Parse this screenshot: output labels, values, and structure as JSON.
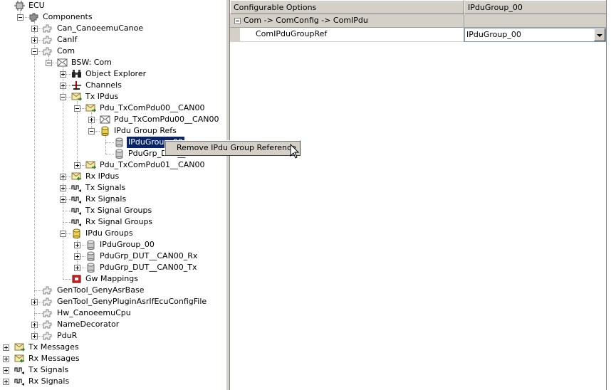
{
  "tree": {
    "items": [
      {
        "label": "ECU",
        "icon": "ecu-chip-icon",
        "expander": "none"
      },
      {
        "label": "Components",
        "icon": "components-puzzle-icon",
        "expander": "minus"
      },
      {
        "label": "Can_CanoeemuCanoe",
        "icon": "module-puzzle-icon",
        "expander": "plus"
      },
      {
        "label": "CanIf",
        "icon": "module-puzzle-icon",
        "expander": "plus"
      },
      {
        "label": "Com",
        "icon": "module-puzzle-icon",
        "expander": "minus"
      },
      {
        "label": "BSW: Com",
        "icon": "envelope-icon",
        "expander": "minus"
      },
      {
        "label": "Object Explorer",
        "icon": "binoculars-icon",
        "expander": "plus"
      },
      {
        "label": "Channels",
        "icon": "channel-icon",
        "expander": "plus"
      },
      {
        "label": "Tx IPdus",
        "icon": "tx-envelope-icon",
        "expander": "minus"
      },
      {
        "label": "Pdu_TxComPdu00__CAN00",
        "icon": "tx-envelope-icon",
        "expander": "minus"
      },
      {
        "label": "Pdu_TxComPdu00__CAN00",
        "icon": "envelope-icon",
        "expander": "plus"
      },
      {
        "label": "IPdu Group Refs",
        "icon": "cylinder-yellow-icon",
        "expander": "minus"
      },
      {
        "label": "IPduGroup_00",
        "icon": "cylinder-gray-icon",
        "expander": "none",
        "selected": true
      },
      {
        "label": "PduGrp_DUT__",
        "icon": "cylinder-gray-icon",
        "expander": "none"
      },
      {
        "label": "Pdu_TxComPdu01__CAN00",
        "icon": "tx-envelope-icon",
        "expander": "plus"
      },
      {
        "label": "Rx IPdus",
        "icon": "rx-envelope-icon",
        "expander": "plus"
      },
      {
        "label": "Tx Signals",
        "icon": "signal-icon",
        "expander": "plus"
      },
      {
        "label": "Rx Signals",
        "icon": "signal-icon",
        "expander": "plus"
      },
      {
        "label": "Tx Signal Groups",
        "icon": "signal-icon",
        "expander": "none"
      },
      {
        "label": "Rx Signal Groups",
        "icon": "signal-icon",
        "expander": "none"
      },
      {
        "label": "IPdu Groups",
        "icon": "cylinder-yellow-icon",
        "expander": "minus"
      },
      {
        "label": "IPduGroup_00",
        "icon": "cylinder-gray-icon",
        "expander": "plus"
      },
      {
        "label": "PduGrp_DUT__CAN00_Rx",
        "icon": "cylinder-gray-icon",
        "expander": "plus"
      },
      {
        "label": "PduGrp_DUT__CAN00_Tx",
        "icon": "cylinder-gray-icon",
        "expander": "plus"
      },
      {
        "label": "Gw Mappings",
        "icon": "gateway-icon",
        "expander": "none"
      },
      {
        "label": "GenTool_GenyAsrBase",
        "icon": "module-puzzle-icon",
        "expander": "none"
      },
      {
        "label": "GenTool_GenyPluginAsrIfEcuConfigFile",
        "icon": "module-puzzle-icon",
        "expander": "plus"
      },
      {
        "label": "Hw_CanoeemuCpu",
        "icon": "module-puzzle-icon",
        "expander": "none"
      },
      {
        "label": "NameDecorator",
        "icon": "module-puzzle-icon",
        "expander": "plus"
      },
      {
        "label": "PduR",
        "icon": "module-puzzle-icon",
        "expander": "plus"
      },
      {
        "label": "Tx Messages",
        "icon": "tx-envelope-icon",
        "expander": "plus"
      },
      {
        "label": "Rx Messages",
        "icon": "rx-envelope-icon",
        "expander": "plus"
      },
      {
        "label": "Tx Signals",
        "icon": "signal-icon",
        "expander": "plus"
      },
      {
        "label": "Rx Signals",
        "icon": "signal-icon",
        "expander": "plus"
      }
    ]
  },
  "context_menu": {
    "remove_label": "Remove IPdu Group Reference"
  },
  "grid": {
    "header_left": "Configurable Options",
    "header_right": "IPduGroup_00",
    "category": "Com -> ComConfig -> ComIPdu",
    "property_name": "ComIPduGroupRef",
    "property_value": "IPduGroup_00"
  },
  "colors": {
    "selection": "#0a246a",
    "chrome": "#d4d0c8"
  }
}
